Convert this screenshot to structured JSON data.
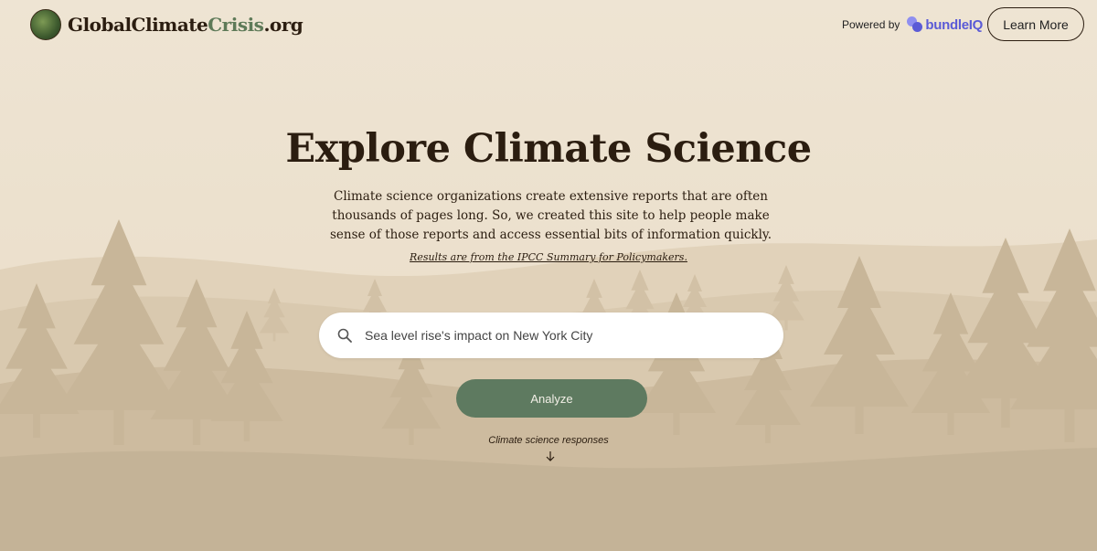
{
  "header": {
    "logo_prefix": "GlobalClimate",
    "logo_accent": "Crisis",
    "logo_suffix": ".org",
    "powered_by": "Powered by",
    "partner_name": "bundleIQ",
    "learn_more": "Learn More"
  },
  "hero": {
    "title": "Explore Climate Science",
    "description": "Climate science organizations create extensive reports that are often thousands of pages long. So, we created this site to help people make sense of those reports and access essential bits of information quickly.",
    "source_note": "Results are from the IPCC Summary for Policymakers."
  },
  "search": {
    "icon": "search-icon",
    "value": "Sea level rise's impact on New York City"
  },
  "actions": {
    "analyze_label": "Analyze"
  },
  "footer": {
    "responses_label": "Climate science responses",
    "arrow_icon": "arrow-down-icon"
  },
  "colors": {
    "background": "#ece1cf",
    "accent_green": "#5e7a60",
    "text_dark": "#2b1d10",
    "brand_purple": "#5b5bd6"
  }
}
